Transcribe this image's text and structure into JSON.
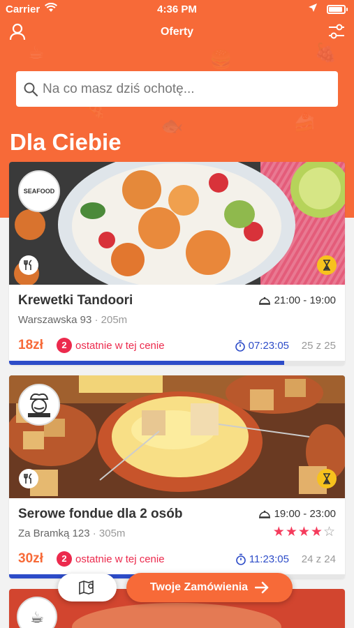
{
  "status_bar": {
    "carrier": "Carrier",
    "time": "4:36 PM"
  },
  "nav": {
    "title": "Oferty",
    "profile_icon": "user-icon",
    "filter_icon": "sliders-icon"
  },
  "search": {
    "placeholder": "Na co masz dziś ochotę..."
  },
  "section": {
    "title": "Dla Ciebie"
  },
  "colors": {
    "brand": "#f76a38",
    "badge_red": "#ec2a4d",
    "timer_blue": "#2d4cc8",
    "hourglass_yellow": "#f7c21d"
  },
  "offers": [
    {
      "name": "Krewetki Tandoori",
      "address": "Warszawska 93",
      "distance": "205m",
      "hours": "21:00 - 19:00",
      "price": "18zł",
      "left_count": "2",
      "left_text": "ostatnie w tej cenie",
      "countdown": "07:23:05",
      "stock": "25 z 25",
      "progress_fraction": 0.82,
      "logo_text": "SEAFOOD"
    },
    {
      "name": "Serowe fondue dla 2 osób",
      "address": "Za Bramką 123",
      "distance": "305m",
      "hours": "19:00 - 23:00",
      "rating": 4,
      "rating_max": 5,
      "price": "30zł",
      "left_count": "2",
      "left_text": "ostatnie w tej cenie",
      "countdown": "11:23:05",
      "stock": "24 z 24",
      "progress_fraction": 0.4
    }
  ],
  "actions": {
    "orders_label": "Twoje Zamówienia",
    "map_icon": "map-pin-icon"
  }
}
